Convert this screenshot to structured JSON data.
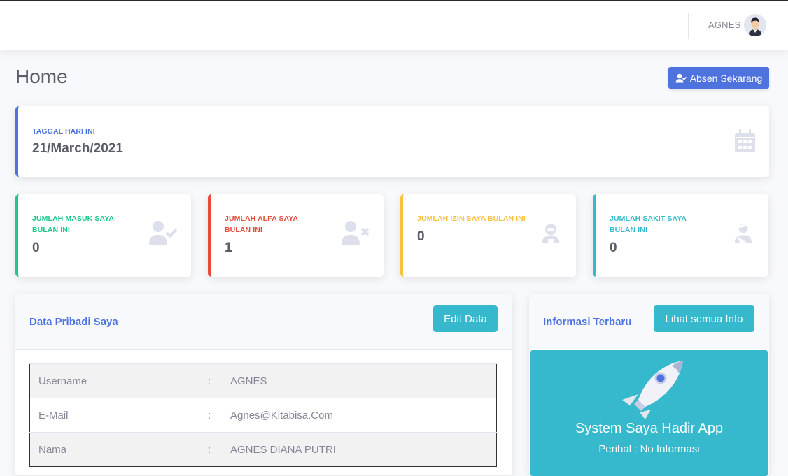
{
  "topbar": {
    "username": "AGNES",
    "avatar_icon": "user-avatar-icon"
  },
  "page": {
    "title": "Home",
    "absen_button": "Absen Sekarang"
  },
  "today": {
    "label": "TAGGAL HARI INI",
    "date": "21/March/2021",
    "icon": "calendar-icon"
  },
  "stats": [
    {
      "label": "JUMLAH MASUK SAYA BULAN INI",
      "value": "0",
      "color": "#1cc88a",
      "icon": "user-check-icon"
    },
    {
      "label": "JUMLAH ALFA SAYA BULAN INI",
      "value": "1",
      "color": "#e74a3b",
      "icon": "user-times-icon"
    },
    {
      "label": "JUMLAH IZIN SAYA BULAN INI",
      "value": "0",
      "color": "#f6c23e",
      "icon": "user-astronaut-icon"
    },
    {
      "label": "JUMLAH SAKIT SAYA BULAN INI",
      "value": "0",
      "color": "#36b9cc",
      "icon": "user-injured-icon"
    }
  ],
  "profile": {
    "title": "Data Pribadi Saya",
    "edit_button": "Edit Data",
    "rows": [
      {
        "label": "Username",
        "colon": ":",
        "value": "AGNES"
      },
      {
        "label": "E-Mail",
        "colon": ":",
        "value": "Agnes@Kitabisa.Com"
      },
      {
        "label": "Nama",
        "colon": ":",
        "value": "AGNES DIANA PUTRI"
      }
    ]
  },
  "news": {
    "title": "Informasi Terbaru",
    "button": "Lihat semua Info",
    "app_title": "System Saya Hadir App",
    "subtitle": "Perihal : No Informasi",
    "icon": "rocket-icon"
  }
}
